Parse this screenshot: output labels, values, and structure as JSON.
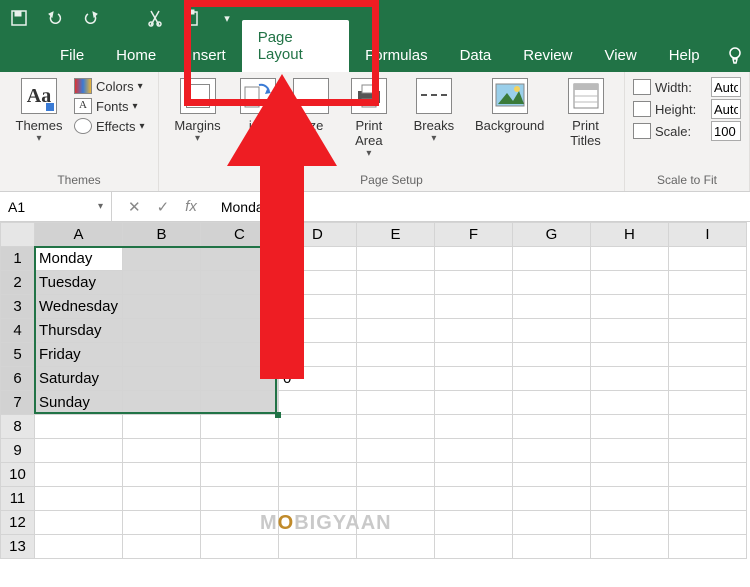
{
  "qat": {
    "save": "save-icon",
    "undo": "undo-icon",
    "redo": "redo-icon",
    "cut": "cut-icon",
    "paste": "paste-icon",
    "customize": "customize-icon"
  },
  "tabs": {
    "file": "File",
    "home": "Home",
    "insert": "Insert",
    "page_layout": "Page Layout",
    "formulas": "Formulas",
    "data": "Data",
    "review": "Review",
    "view": "View",
    "help": "Help"
  },
  "ribbon": {
    "themes": {
      "button": "Themes",
      "colors": "Colors",
      "fonts": "Fonts",
      "effects": "Effects",
      "group_label": "Themes",
      "aa_glyph": "Aa"
    },
    "page_setup": {
      "margins": "Margins",
      "orientation_part": "ion",
      "size": "Size",
      "print_area": "Print\nArea",
      "breaks": "Breaks",
      "background": "Background",
      "print_titles": "Print\nTitles",
      "group_label": "Page Setup"
    },
    "scale_to_fit": {
      "width_label": "Width:",
      "width_value": "Auto",
      "height_label": "Height:",
      "height_value": "Auto",
      "scale_label": "Scale:",
      "scale_value": "100",
      "group_label": "Scale to Fit"
    }
  },
  "formula_bar": {
    "name_box": "A1",
    "fx_value": "Monday"
  },
  "columns": [
    "A",
    "B",
    "C",
    "D",
    "E",
    "F",
    "G",
    "H",
    "I"
  ],
  "rows_visible": 13,
  "cells": {
    "A1": "Monday",
    "A2": "Tuesday",
    "A3": "Wednesday",
    "A4": "Thursday",
    "A5": "Friday",
    "A6": "Saturday",
    "A7": "Sunday",
    "D6": "0"
  },
  "selection": {
    "cols": [
      "A",
      "B",
      "C"
    ],
    "rows": [
      1,
      2,
      3,
      4,
      5,
      6,
      7
    ],
    "active": "A1"
  },
  "watermark": "MOBIGYAAN"
}
